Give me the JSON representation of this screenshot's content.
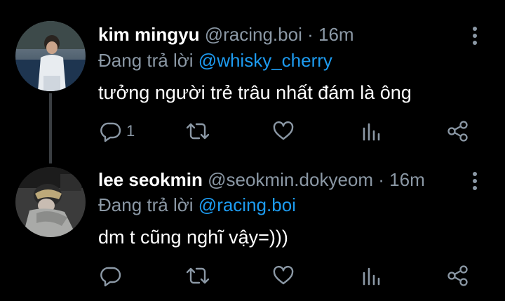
{
  "colors": {
    "background": "#000000",
    "text": "#ffffff",
    "muted": "#8b98a5",
    "accent": "#1d9bf0",
    "thread_line": "#3a3e42"
  },
  "tweets": [
    {
      "name": "kim mingyu",
      "handle": "@racing.boi",
      "separator": "·",
      "time": "16m",
      "reply_prefix": "Đang trả lời",
      "reply_to": "@whisky_cherry",
      "text": "tưởng người trẻ trâu nhất đám là ông",
      "reply_count": "1",
      "icons": [
        "reply-icon",
        "retweet-icon",
        "like-icon",
        "stats-icon",
        "share-icon"
      ]
    },
    {
      "name": "lee seokmin",
      "handle": "@seokmin.dokyeom",
      "separator": "·",
      "time": "16m",
      "reply_prefix": "Đang trả lời",
      "reply_to": "@racing.boi",
      "text": "dm t cũng nghĩ vậy=)))",
      "reply_count": "",
      "icons": [
        "reply-icon",
        "retweet-icon",
        "like-icon",
        "stats-icon",
        "share-icon"
      ]
    }
  ]
}
